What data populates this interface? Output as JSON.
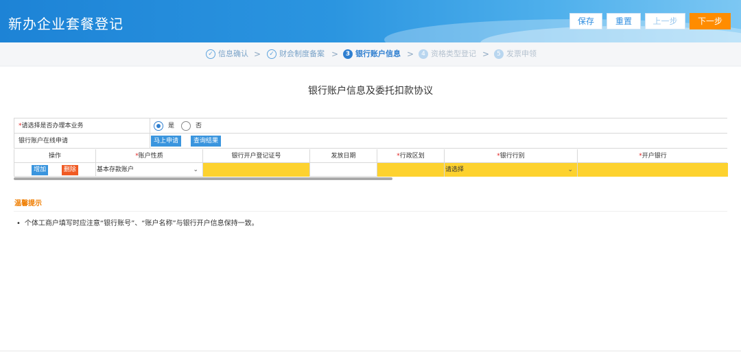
{
  "header": {
    "title": "新办企业套餐登记",
    "buttons": {
      "save": "保存",
      "reset": "重置",
      "prev": "上一步",
      "next": "下一步"
    }
  },
  "steps": [
    {
      "label": "信息确认",
      "marker": "✓"
    },
    {
      "label": "财会制度备案",
      "marker": "✓"
    },
    {
      "label": "银行账户信息",
      "marker": "3"
    },
    {
      "label": "资格类型登记",
      "marker": "4"
    },
    {
      "label": "发票申领",
      "marker": "5"
    }
  ],
  "page_title": "银行账户信息及委托扣款协议",
  "form": {
    "row1": {
      "req": "*",
      "label": "请选择是否办理本业务",
      "yes": "是",
      "no": "否"
    },
    "row2": {
      "label": "银行账户在线申请",
      "apply": "马上申请",
      "query": "查询结果"
    }
  },
  "grid": {
    "headers": {
      "op": "操作",
      "type": "账户性质",
      "cert": "银行开户登记证号",
      "date": "发放日期",
      "region": "行政区划",
      "bank_cat": "银行行别",
      "bank": "开户银行"
    },
    "req": "*",
    "row": {
      "add": "增加",
      "del": "删除",
      "type": "基本存款账户",
      "bank_cat": "请选择"
    }
  },
  "tips": {
    "title": "温馨提示",
    "items": [
      "个体工商户填写时应注意“银行账号”、“账户名称”与银行开户信息保持一致。"
    ]
  },
  "colors": {
    "accent": "#2f7fd0",
    "next_button": "#ff8c00",
    "required_field": "#fdd22f",
    "tip_title": "#ef7d00"
  }
}
